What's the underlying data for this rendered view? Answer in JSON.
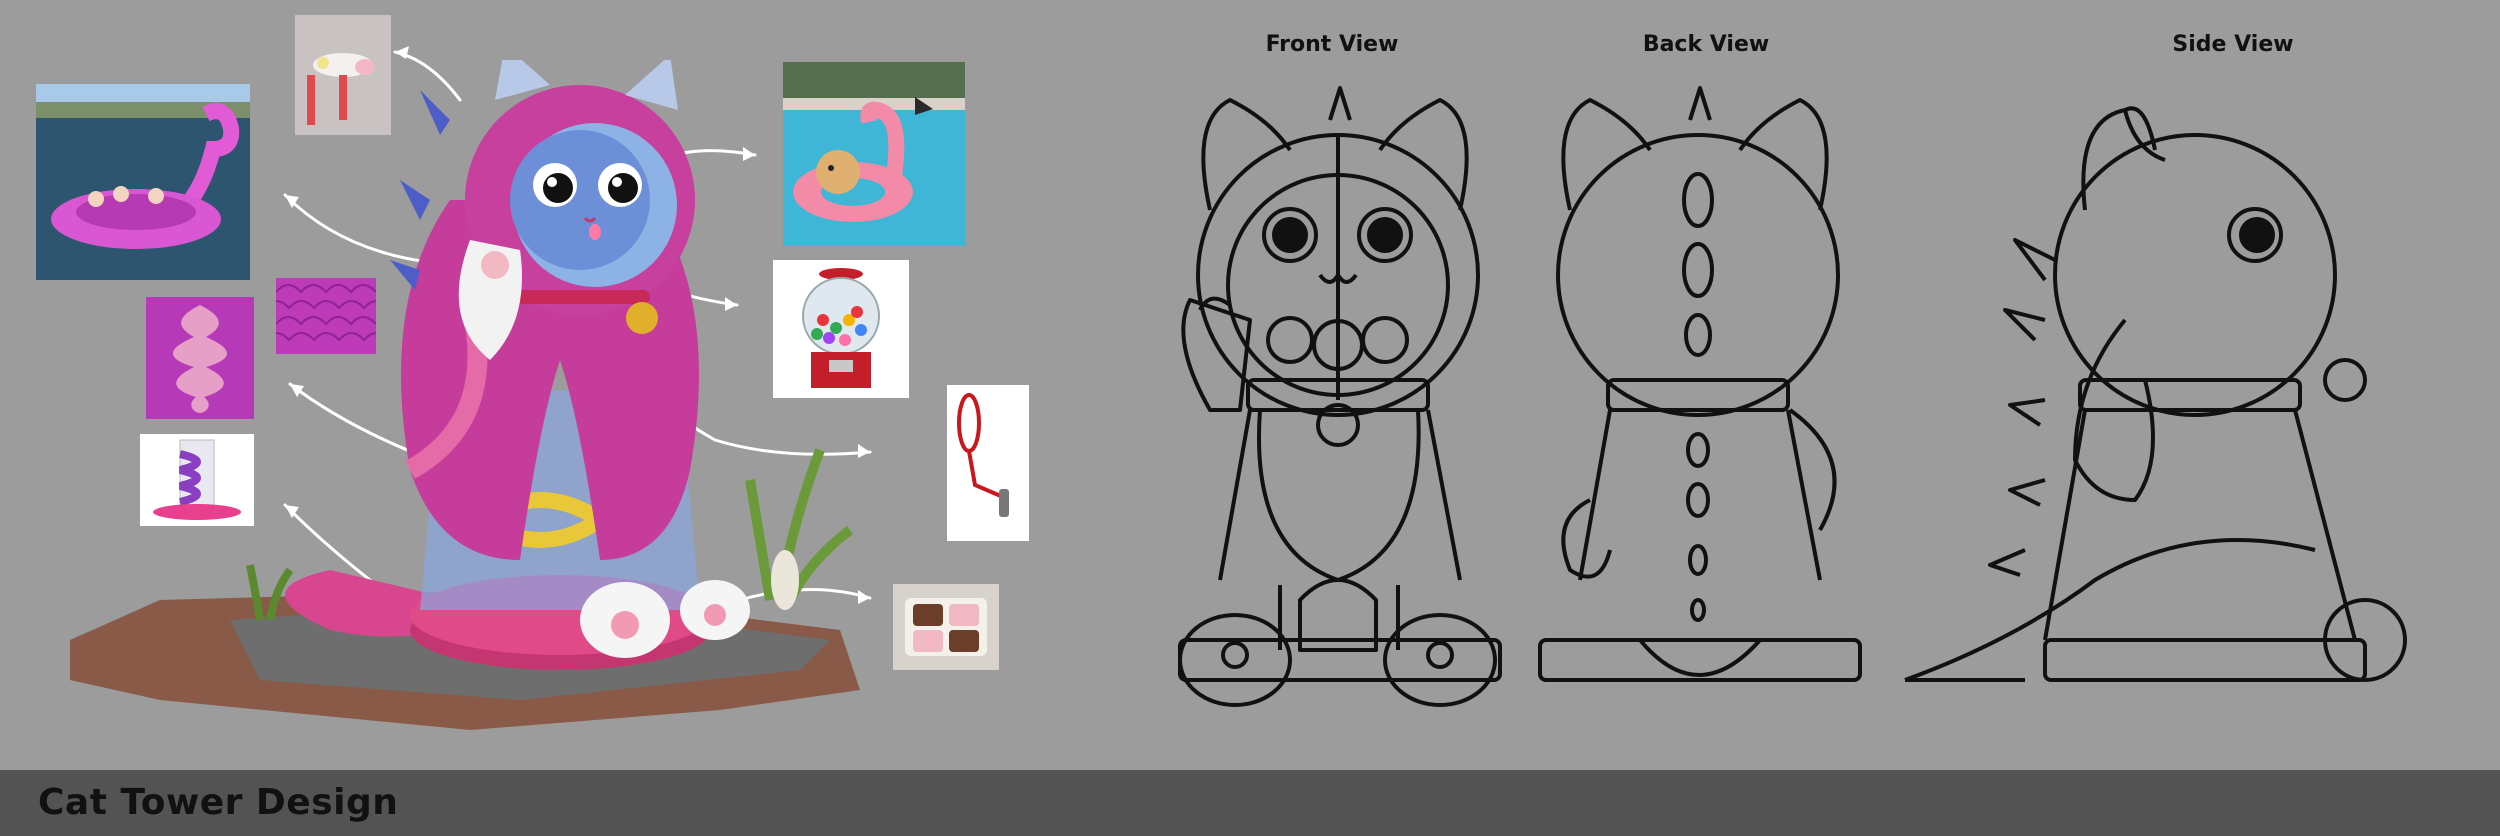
{
  "sheet": {
    "title": "Cat Tower Design"
  },
  "views": {
    "front": "Front View",
    "back": "Back View",
    "side": "Side View"
  },
  "colors": {
    "background": "#9c9c9c",
    "footer": "#535353",
    "pink": "#e0409a",
    "magenta": "#b43fb6",
    "blue": "#6c8fd8",
    "ground": "#8a5a48"
  },
  "references": [
    {
      "name": "flamingo-float-legs-photo",
      "icon": "flamingo-legs"
    },
    {
      "name": "flamingo-island-float-photo",
      "icon": "flamingo-float"
    },
    {
      "name": "dog-on-flamingo-ring-photo",
      "icon": "flamingo-ring"
    },
    {
      "name": "gumball-machine-photo",
      "icon": "gumball-machine"
    },
    {
      "name": "pet-leash-photo",
      "icon": "leash"
    },
    {
      "name": "cat-paw-cakes-photo",
      "icon": "paw-cakes"
    },
    {
      "name": "fish-scale-pattern-swatch",
      "icon": "scale-pattern"
    },
    {
      "name": "spine-pattern-swatch",
      "icon": "spine-pattern"
    },
    {
      "name": "spiral-tube-photo",
      "icon": "spiral-tube"
    }
  ]
}
